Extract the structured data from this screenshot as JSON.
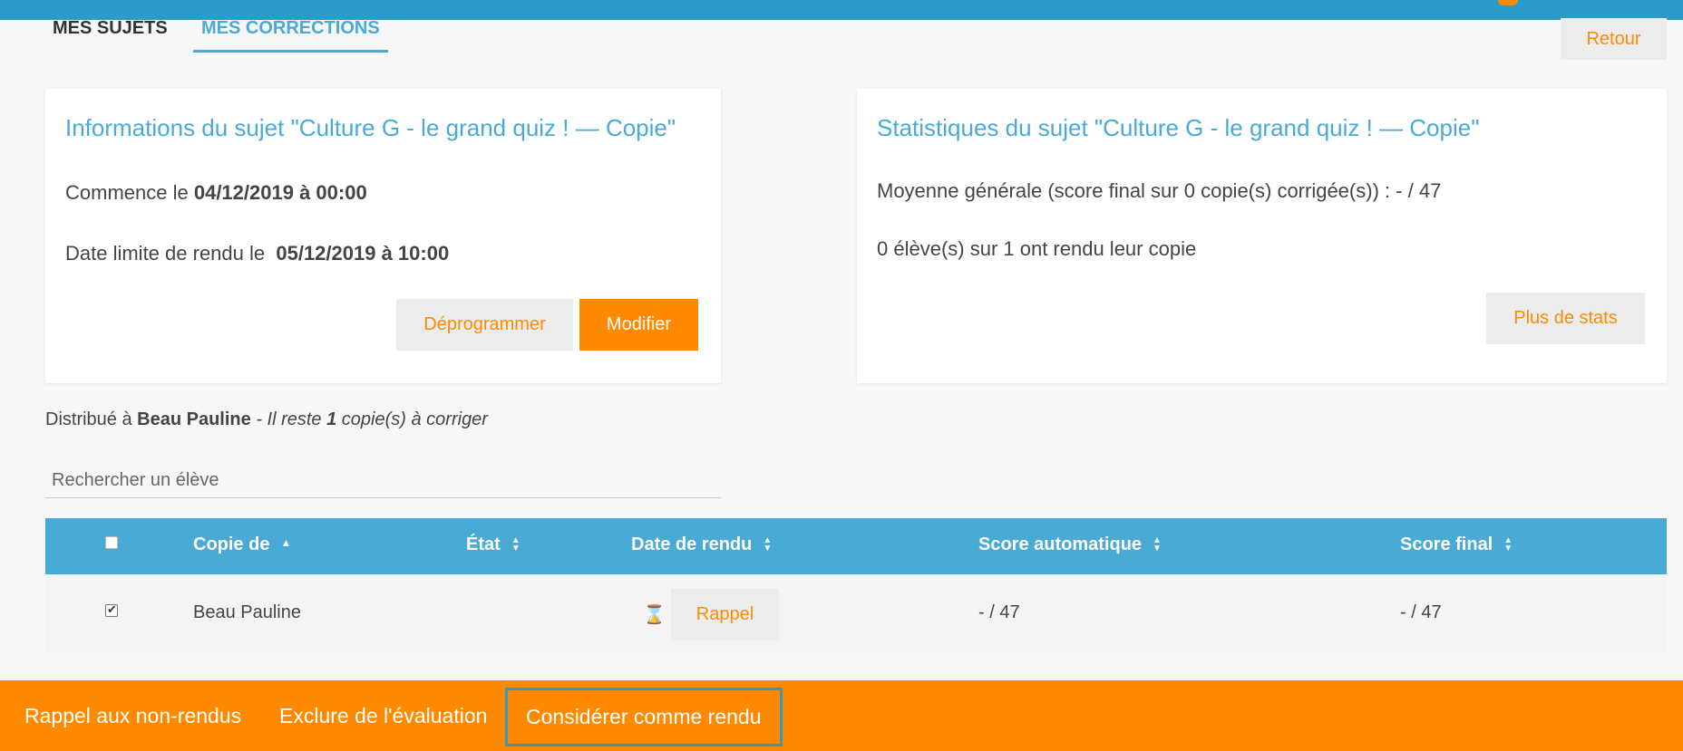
{
  "tabs": {
    "subjects": "MES SUJETS",
    "corrections": "MES CORRECTIONS"
  },
  "header": {
    "back_label": "Retour"
  },
  "info_card": {
    "title": "Informations du sujet \"Culture G - le grand quiz ! — Copie\"",
    "start_prefix": "Commence le ",
    "start_value": "04/12/2019 à 00:00",
    "deadline_prefix": "Date limite de rendu le ",
    "deadline_value": "05/12/2019 à 10:00",
    "unschedule_label": "Déprogrammer",
    "edit_label": "Modifier"
  },
  "stats_card": {
    "title": "Statistiques du sujet \"Culture G - le grand quiz ! — Copie\"",
    "average": "Moyenne générale (score final sur 0 copie(s) corrigée(s)) : - / 47",
    "submitted": "0 élève(s) sur 1 ont rendu leur copie",
    "more_stats_label": "Plus de stats"
  },
  "distribution": {
    "prefix": "Distribué à ",
    "student": "Beau Pauline",
    "remaining_prefix": " - Il reste ",
    "remaining_count": "1",
    "remaining_suffix": " copie(s) à corriger"
  },
  "search": {
    "placeholder": "Rechercher un élève",
    "value": ""
  },
  "table": {
    "columns": [
      "Copie de",
      "État",
      "Date de rendu",
      "Score automatique",
      "Score final"
    ],
    "rows": [
      {
        "checked": true,
        "student": "Beau Pauline",
        "state": "",
        "date_status": "hourglass-icon",
        "reminder_label": "Rappel",
        "auto_score": "- / 47",
        "final_score": "- / 47"
      }
    ]
  },
  "bottom_bar": {
    "actions": [
      "Rappel aux non-rendus",
      "Exclure de l'évaluation",
      "Considérer comme rendu"
    ]
  },
  "colors": {
    "primary": "#4aaad6",
    "accent": "#ff8a00",
    "topbar": "#2b9cc9"
  }
}
